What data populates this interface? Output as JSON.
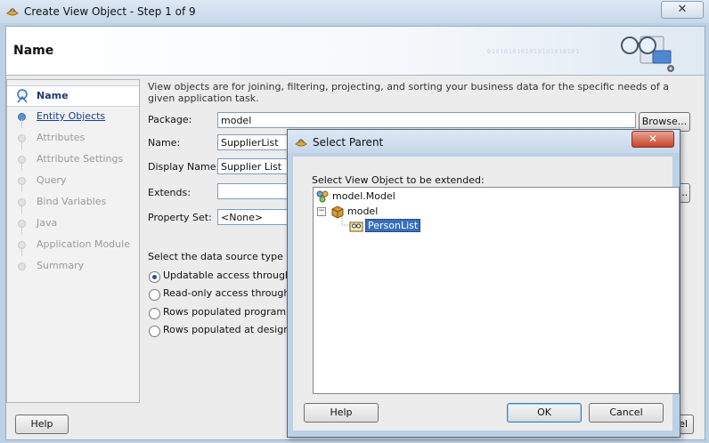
{
  "main_window": {
    "title": "Create View Object - Step 1 of 9",
    "close_label": "✕"
  },
  "header": {
    "title": "Name",
    "binary_decoration": "0101010101010101010101"
  },
  "nav": {
    "items": [
      {
        "label": "Name",
        "state": "current"
      },
      {
        "label": "Entity Objects",
        "state": "link"
      },
      {
        "label": "Attributes",
        "state": "disabled"
      },
      {
        "label": "Attribute Settings",
        "state": "disabled"
      },
      {
        "label": "Query",
        "state": "disabled"
      },
      {
        "label": "Bind Variables",
        "state": "disabled"
      },
      {
        "label": "Java",
        "state": "disabled"
      },
      {
        "label": "Application Module",
        "state": "disabled"
      },
      {
        "label": "Summary",
        "state": "disabled"
      }
    ]
  },
  "form": {
    "description": "View objects are for joining, filtering, projecting, and sorting your business data for the specific needs of a given application task.",
    "package_label": "Package:",
    "package_value": "model",
    "browse_label": "Browse...",
    "name_label": "Name:",
    "name_value": "SupplierList",
    "display_name_label": "Display Name:",
    "display_name_value": "Supplier List",
    "extends_label": "Extends:",
    "extends_value": "",
    "extends_browse_label": "...",
    "property_set_label": "Property Set:",
    "property_set_value": "<None>",
    "datasource_prompt": "Select the data source type you",
    "radio_options": [
      {
        "label": "Updatable access through en",
        "checked": true
      },
      {
        "label": "Read-only access through SQ",
        "checked": false
      },
      {
        "label": "Rows populated programmati",
        "checked": false
      },
      {
        "label": "Rows populated at design tim",
        "checked": false
      }
    ]
  },
  "footer": {
    "help_label": "Help",
    "partial_right_label": "el"
  },
  "dialog": {
    "title": "Select Parent",
    "close_label": "✕",
    "prompt": "Select View Object to be extended:",
    "tree": {
      "root": "model.Model",
      "package": "model",
      "child": "PersonList"
    },
    "help_label": "Help",
    "ok_label": "OK",
    "cancel_label": "Cancel"
  },
  "colors": {
    "selection": "#3a6fbd",
    "link": "#1a3e8c",
    "window_frame": "#bcd0e6",
    "close_red": "#c7432b"
  }
}
